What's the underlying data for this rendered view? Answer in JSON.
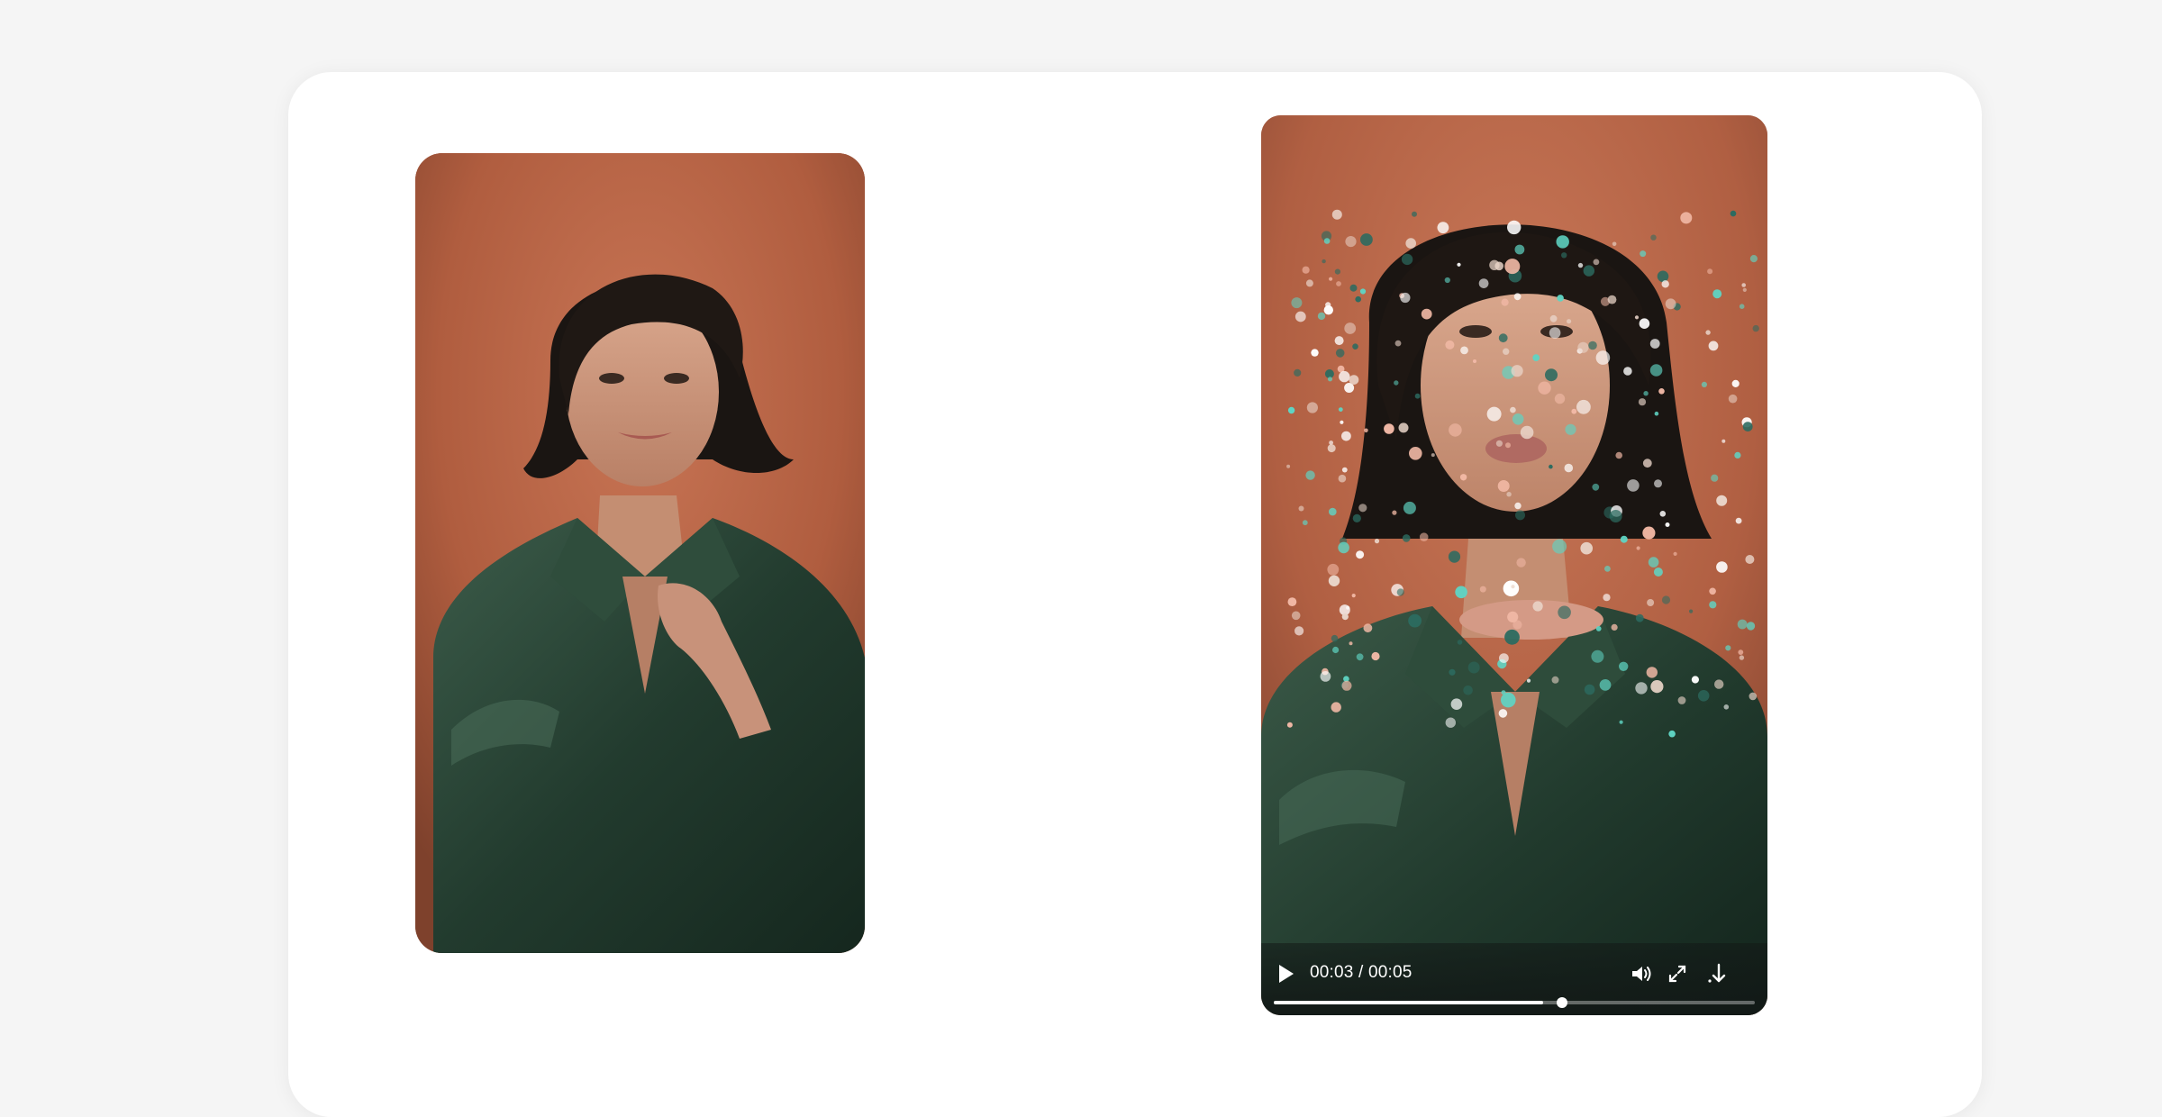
{
  "video": {
    "current_time": "00:03",
    "separator": "/",
    "duration": "00:05",
    "buffered": 0.56,
    "played": 0.6
  },
  "icons": {
    "play": "play-icon",
    "volume": "volume-icon",
    "fullscreen": "fullscreen-icon",
    "download": "download-icon"
  },
  "colors": {
    "page_bg": "#f5f5f5",
    "card_bg": "#ffffff",
    "backdrop": "#b05d3f",
    "blouse": "#2a4536",
    "hair": "#1a1512",
    "particle_teal": "#5fd4c3",
    "particle_pink": "#f2b9a6"
  }
}
